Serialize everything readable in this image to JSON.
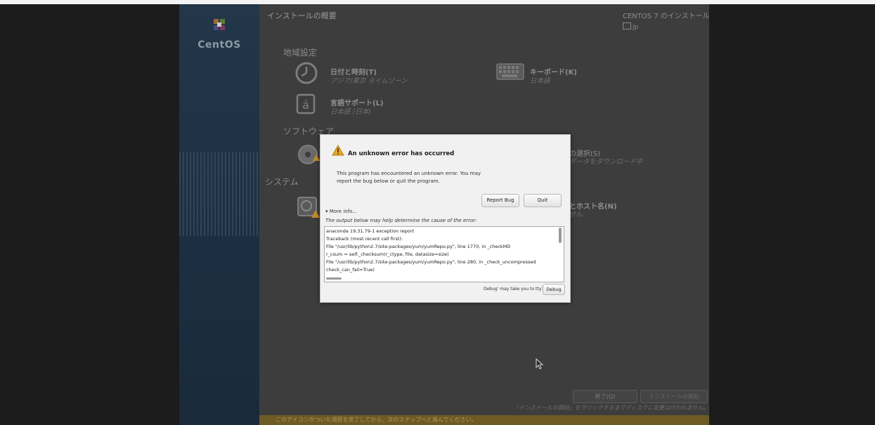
{
  "sidebar": {
    "logo_text": "CentOS"
  },
  "header": {
    "title": "インストールの概要",
    "install_title": "CENTOS 7 のインストール",
    "keyboard_layout": "jp"
  },
  "sections": {
    "localization": "地域設定",
    "software": "ソフトウェア",
    "system": "システム"
  },
  "spokes": {
    "datetime": {
      "title": "日付と時刻(T)",
      "status": "アジア/東京 タイムゾーン"
    },
    "keyboard": {
      "title": "キーボード(K)",
      "status": "日本語"
    },
    "language": {
      "title": "言語サポート(L)",
      "status": "日本語 (日本)"
    },
    "software_selection": {
      "title_partial": "の選択(S)",
      "status_partial": "データをダウンロード中"
    },
    "network": {
      "title_partial": "とホスト名(N)",
      "status_partial": "せん"
    }
  },
  "bottom": {
    "quit_label": "終了(Q)",
    "begin_label": "インストールの開始",
    "note": "「インストールの開始」をクリックするまでディスクに変更は行われません。",
    "warning": "このアイコンがついた項目を完了してから、次のステップへと進んでください。"
  },
  "dialog": {
    "title": "An unknown error has occurred",
    "message_line1": "This program has encountered an unknown error. You may",
    "message_line2": "report the bug below or quit the program.",
    "report_bug_label": "Report Bug",
    "quit_label": "Quit",
    "more_info_label": "▾ More info...",
    "output_note": "The output below may help determine the cause of the error:",
    "output_lines": [
      "anaconda 19.31.79-1 exception report",
      "Traceback (most recent call first):",
      "  File \"/usr/lib/python2.7/site-packages/yum/yumRepo.py\", line 1770, in _checkMD",
      "    r_csum = self._checksum(r_ctype, file, datasize=size)",
      "  File \"/usr/lib/python2.7/site-packages/yum/yumRepo.py\", line 280, in _check_uncompressed",
      "    check_can_fail=True)"
    ],
    "debug_note": "Debug' may take you to tty1",
    "debug_label": "Debug"
  },
  "colors": {
    "dialog_bg": "#f1f1f1",
    "overlay_bg": "#3d3d3d",
    "warning_bar": "#6d5a24",
    "warning_icon": "#e8a92b",
    "sidebar": "#1d3044"
  }
}
